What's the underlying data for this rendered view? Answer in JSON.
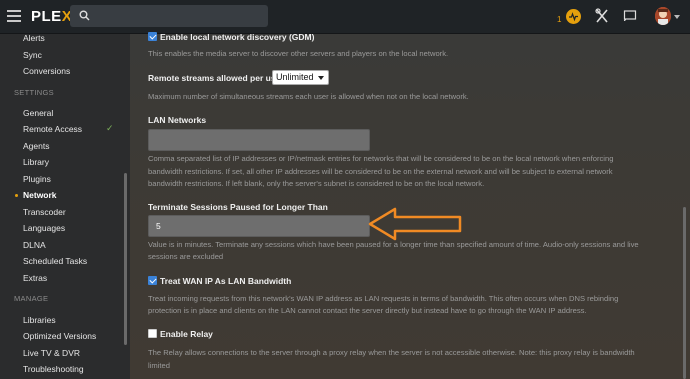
{
  "header": {
    "logo_main": "PLE",
    "logo_x": "X",
    "activity_count": "1"
  },
  "sidebar": {
    "items_top": [
      {
        "label": "Alerts"
      },
      {
        "label": "Sync"
      },
      {
        "label": "Conversions"
      }
    ],
    "settings_heading": "SETTINGS",
    "settings_items": [
      {
        "label": "General"
      },
      {
        "label": "Remote Access",
        "check": "✓"
      },
      {
        "label": "Agents"
      },
      {
        "label": "Library"
      },
      {
        "label": "Plugins"
      },
      {
        "label": "Network",
        "active": true
      },
      {
        "label": "Transcoder"
      },
      {
        "label": "Languages"
      },
      {
        "label": "DLNA"
      },
      {
        "label": "Scheduled Tasks"
      },
      {
        "label": "Extras"
      }
    ],
    "manage_heading": "MANAGE",
    "manage_items": [
      {
        "label": "Libraries"
      },
      {
        "label": "Optimized Versions"
      },
      {
        "label": "Live TV & DVR"
      },
      {
        "label": "Troubleshooting"
      }
    ]
  },
  "settings": {
    "gdm": {
      "label": "Enable local network discovery (GDM)",
      "checked": true,
      "help": "This enables the media server to discover other servers and players on the local network."
    },
    "remote_streams": {
      "label": "Remote streams allowed per user",
      "value": "Unlimited",
      "help": "Maximum number of simultaneous streams each user is allowed when not on the local network."
    },
    "lan_networks": {
      "label": "LAN Networks",
      "value": "",
      "help_1": "Comma separated list of IP addresses or IP/netmask entries for networks that will be considered to be on the local network when enforcing",
      "help_2": "bandwidth restrictions. If set, all other IP addresses will be considered to be on the external network and will be subject to external network",
      "help_3": "bandwidth restrictions. If left blank, only the server's subnet is considered to be on the local network."
    },
    "terminate_sessions": {
      "label": "Terminate Sessions Paused for Longer Than",
      "value": "5",
      "help_1": "Value is in minutes. Terminate any sessions which have been paused for a longer time than specified amount of time. Audio-only sessions and live",
      "help_2": "sessions are excluded"
    },
    "wan_ip": {
      "label": "Treat WAN IP As LAN Bandwidth",
      "checked": true,
      "help_1": "Treat incoming requests from this network's WAN IP address as LAN requests in terms of bandwidth. This often occurs when DNS rebinding",
      "help_2": "protection is in place and clients on the LAN cannot contact the server directly but instead have to go through the WAN IP address."
    },
    "relay": {
      "label": "Enable Relay",
      "checked": false,
      "help_1": "The Relay allows connections to the server through a proxy relay when the server is not accessible otherwise. Note: this proxy relay is bandwidth",
      "help_2": "limited"
    }
  },
  "colors": {
    "accent": "#e5a00d",
    "arrow": "#f08a24",
    "checkbox_checked": "#3a82d8",
    "check_mark": "#7db15a"
  }
}
